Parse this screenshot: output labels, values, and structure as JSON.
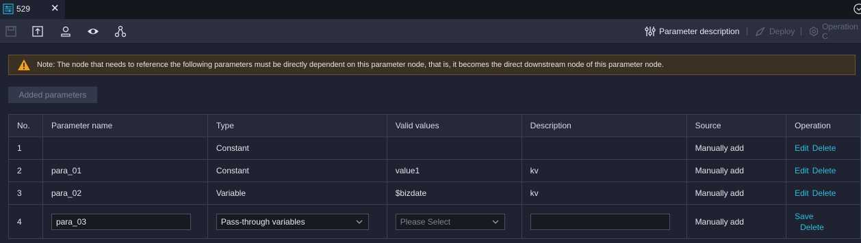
{
  "tab": {
    "title": "529",
    "close_glyph": "✕"
  },
  "toolbar": {
    "icons": [
      "save-icon",
      "submit-icon",
      "user-icon",
      "preview-icon",
      "graph-icon"
    ],
    "parameter_description": "Parameter description",
    "deploy": "Deploy",
    "operation_center": "Operation C"
  },
  "notice": {
    "text": "Note: The node that needs to reference the following parameters must be directly dependent on this parameter node, that is, it becomes the direct downstream node of this parameter node."
  },
  "added_parameters_label": "Added parameters",
  "table": {
    "headers": [
      "No.",
      "Parameter name",
      "Type",
      "Valid values",
      "Description",
      "Source",
      "Operation"
    ],
    "rows": [
      {
        "no": "1",
        "name": "",
        "type": "Constant",
        "valid": "",
        "desc": "",
        "source": "Manually add",
        "op1": "Edit",
        "op2": "Delete"
      },
      {
        "no": "2",
        "name": "para_01",
        "type": "Constant",
        "valid": "value1",
        "desc": "kv",
        "source": "Manually add",
        "op1": "Edit",
        "op2": "Delete"
      },
      {
        "no": "3",
        "name": "para_02",
        "type": "Variable",
        "valid": "$bizdate",
        "desc": "kv",
        "source": "Manually add",
        "op1": "Edit",
        "op2": "Delete"
      }
    ],
    "edit_row": {
      "no": "4",
      "name_value": "para_03",
      "type_selected": "Pass-through variables",
      "valid_placeholder": "Please Select",
      "desc_value": "",
      "source": "Manually add",
      "save": "Save",
      "delete": "Delete"
    }
  },
  "colors": {
    "accent": "#2cbde0",
    "warning": "#f0a020",
    "background": "#1f2230"
  }
}
